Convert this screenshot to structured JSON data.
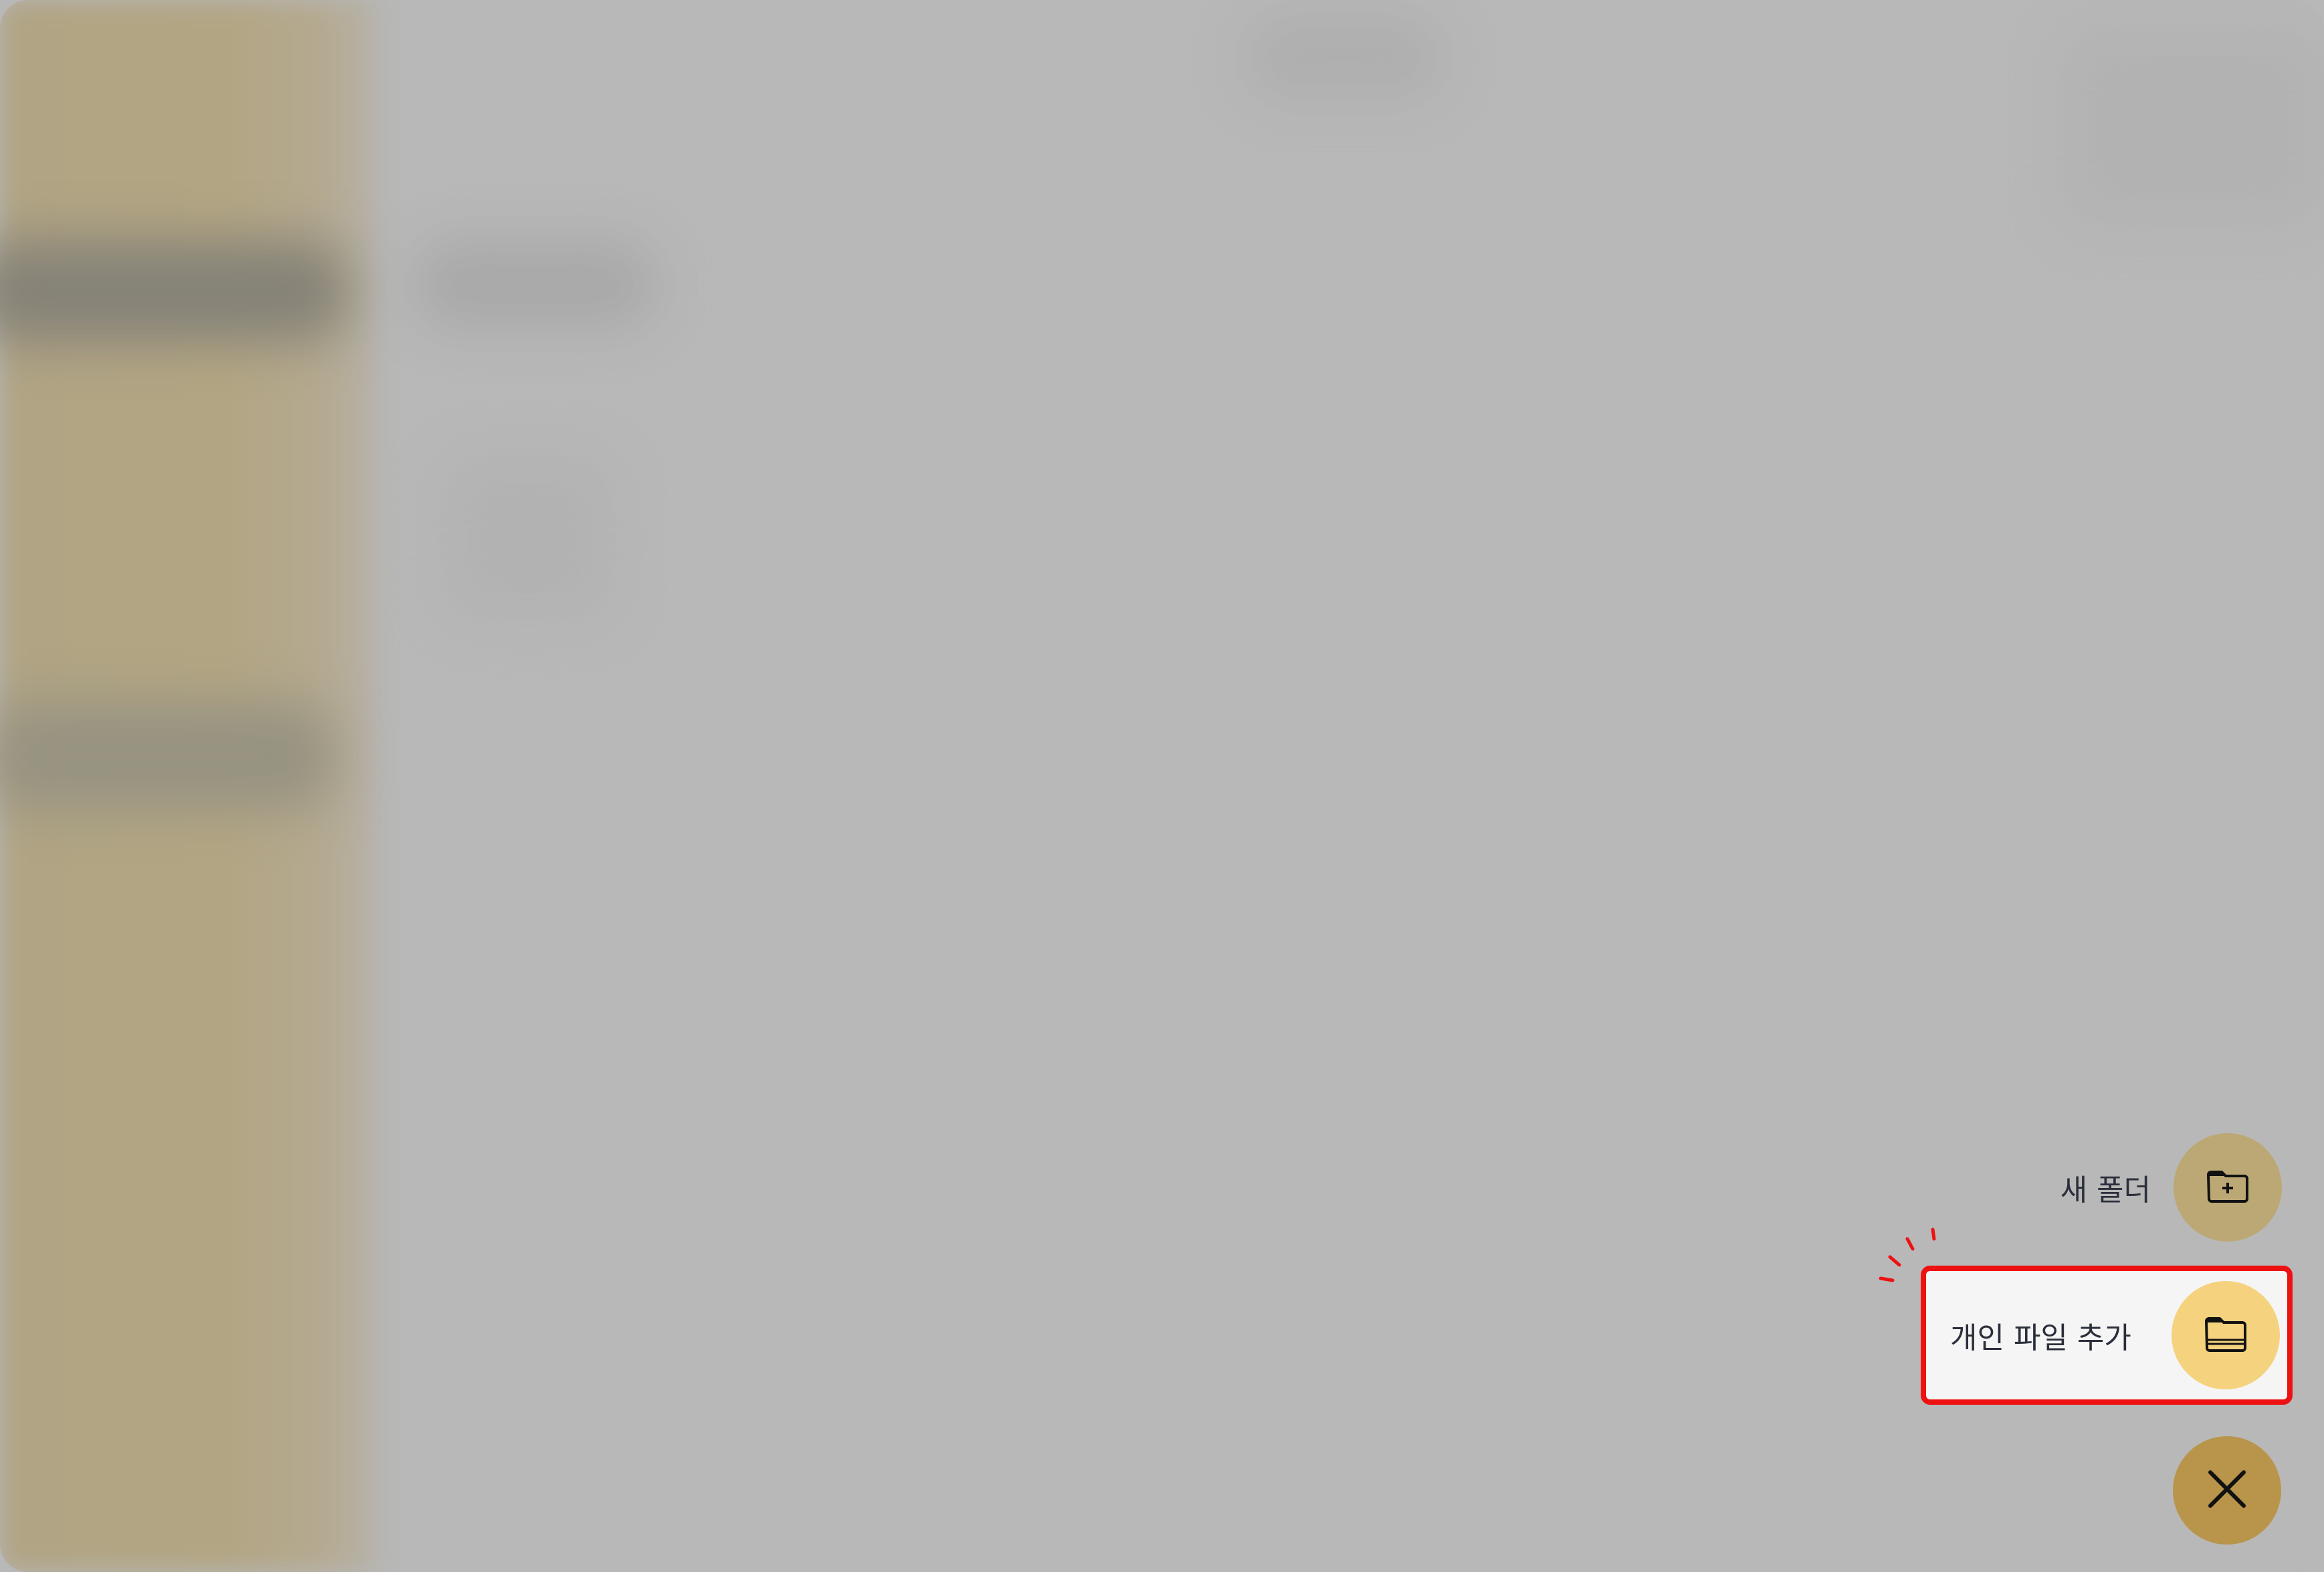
{
  "fab_menu": {
    "new_folder_label": "새 폴더",
    "new_folder_icon": "folder-plus-icon",
    "add_personal_file_label": "개인 파일 추가",
    "add_personal_file_icon": "folder-open-icon",
    "close_icon": "close-icon"
  },
  "colors": {
    "highlight_border": "#ee1111",
    "close_fab": "#b8954a",
    "file_fab": "#f5d27e",
    "folder_fab": "#bca874"
  }
}
